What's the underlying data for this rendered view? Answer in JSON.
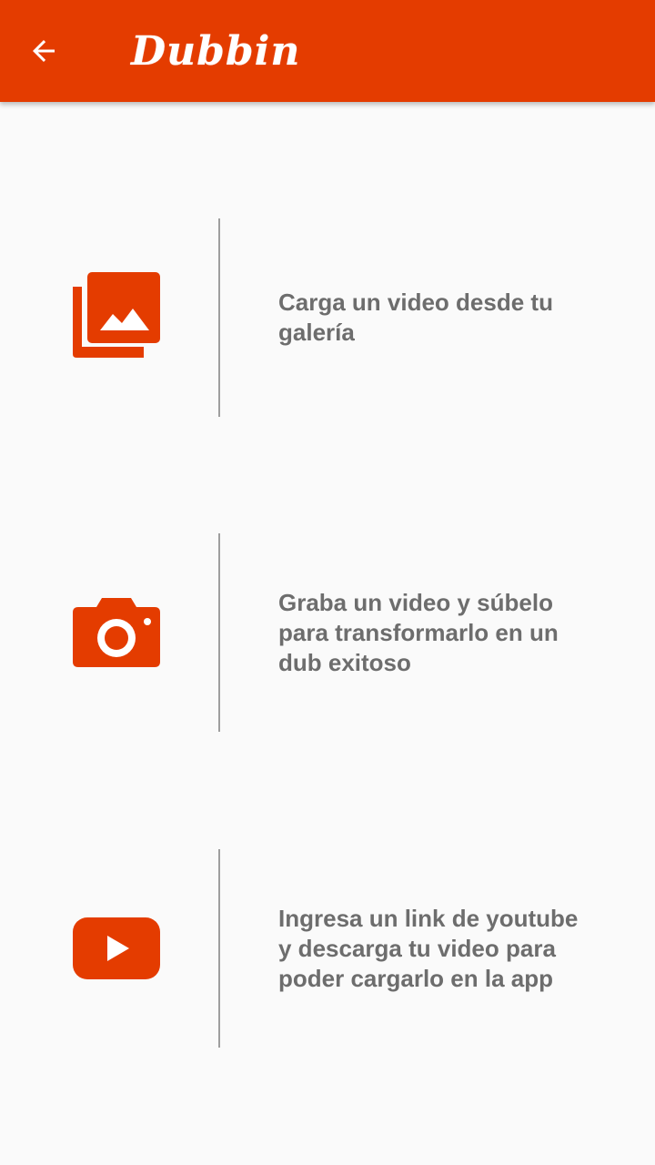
{
  "appbar": {
    "logo_text": "Dubbin",
    "back_icon": "arrow-back-icon"
  },
  "colors": {
    "primary": "#e43c00",
    "background": "#fafafa",
    "text": "#6d6d6d",
    "divider": "#9e9e9e"
  },
  "options": [
    {
      "icon": "gallery-icon",
      "label": "Carga un video desde tu galería"
    },
    {
      "icon": "camera-icon",
      "label": "Graba un video y súbelo para transformarlo en un dub exitoso"
    },
    {
      "icon": "youtube-icon",
      "label": "Ingresa un link de youtube y descarga tu video para poder cargarlo en la app"
    }
  ]
}
